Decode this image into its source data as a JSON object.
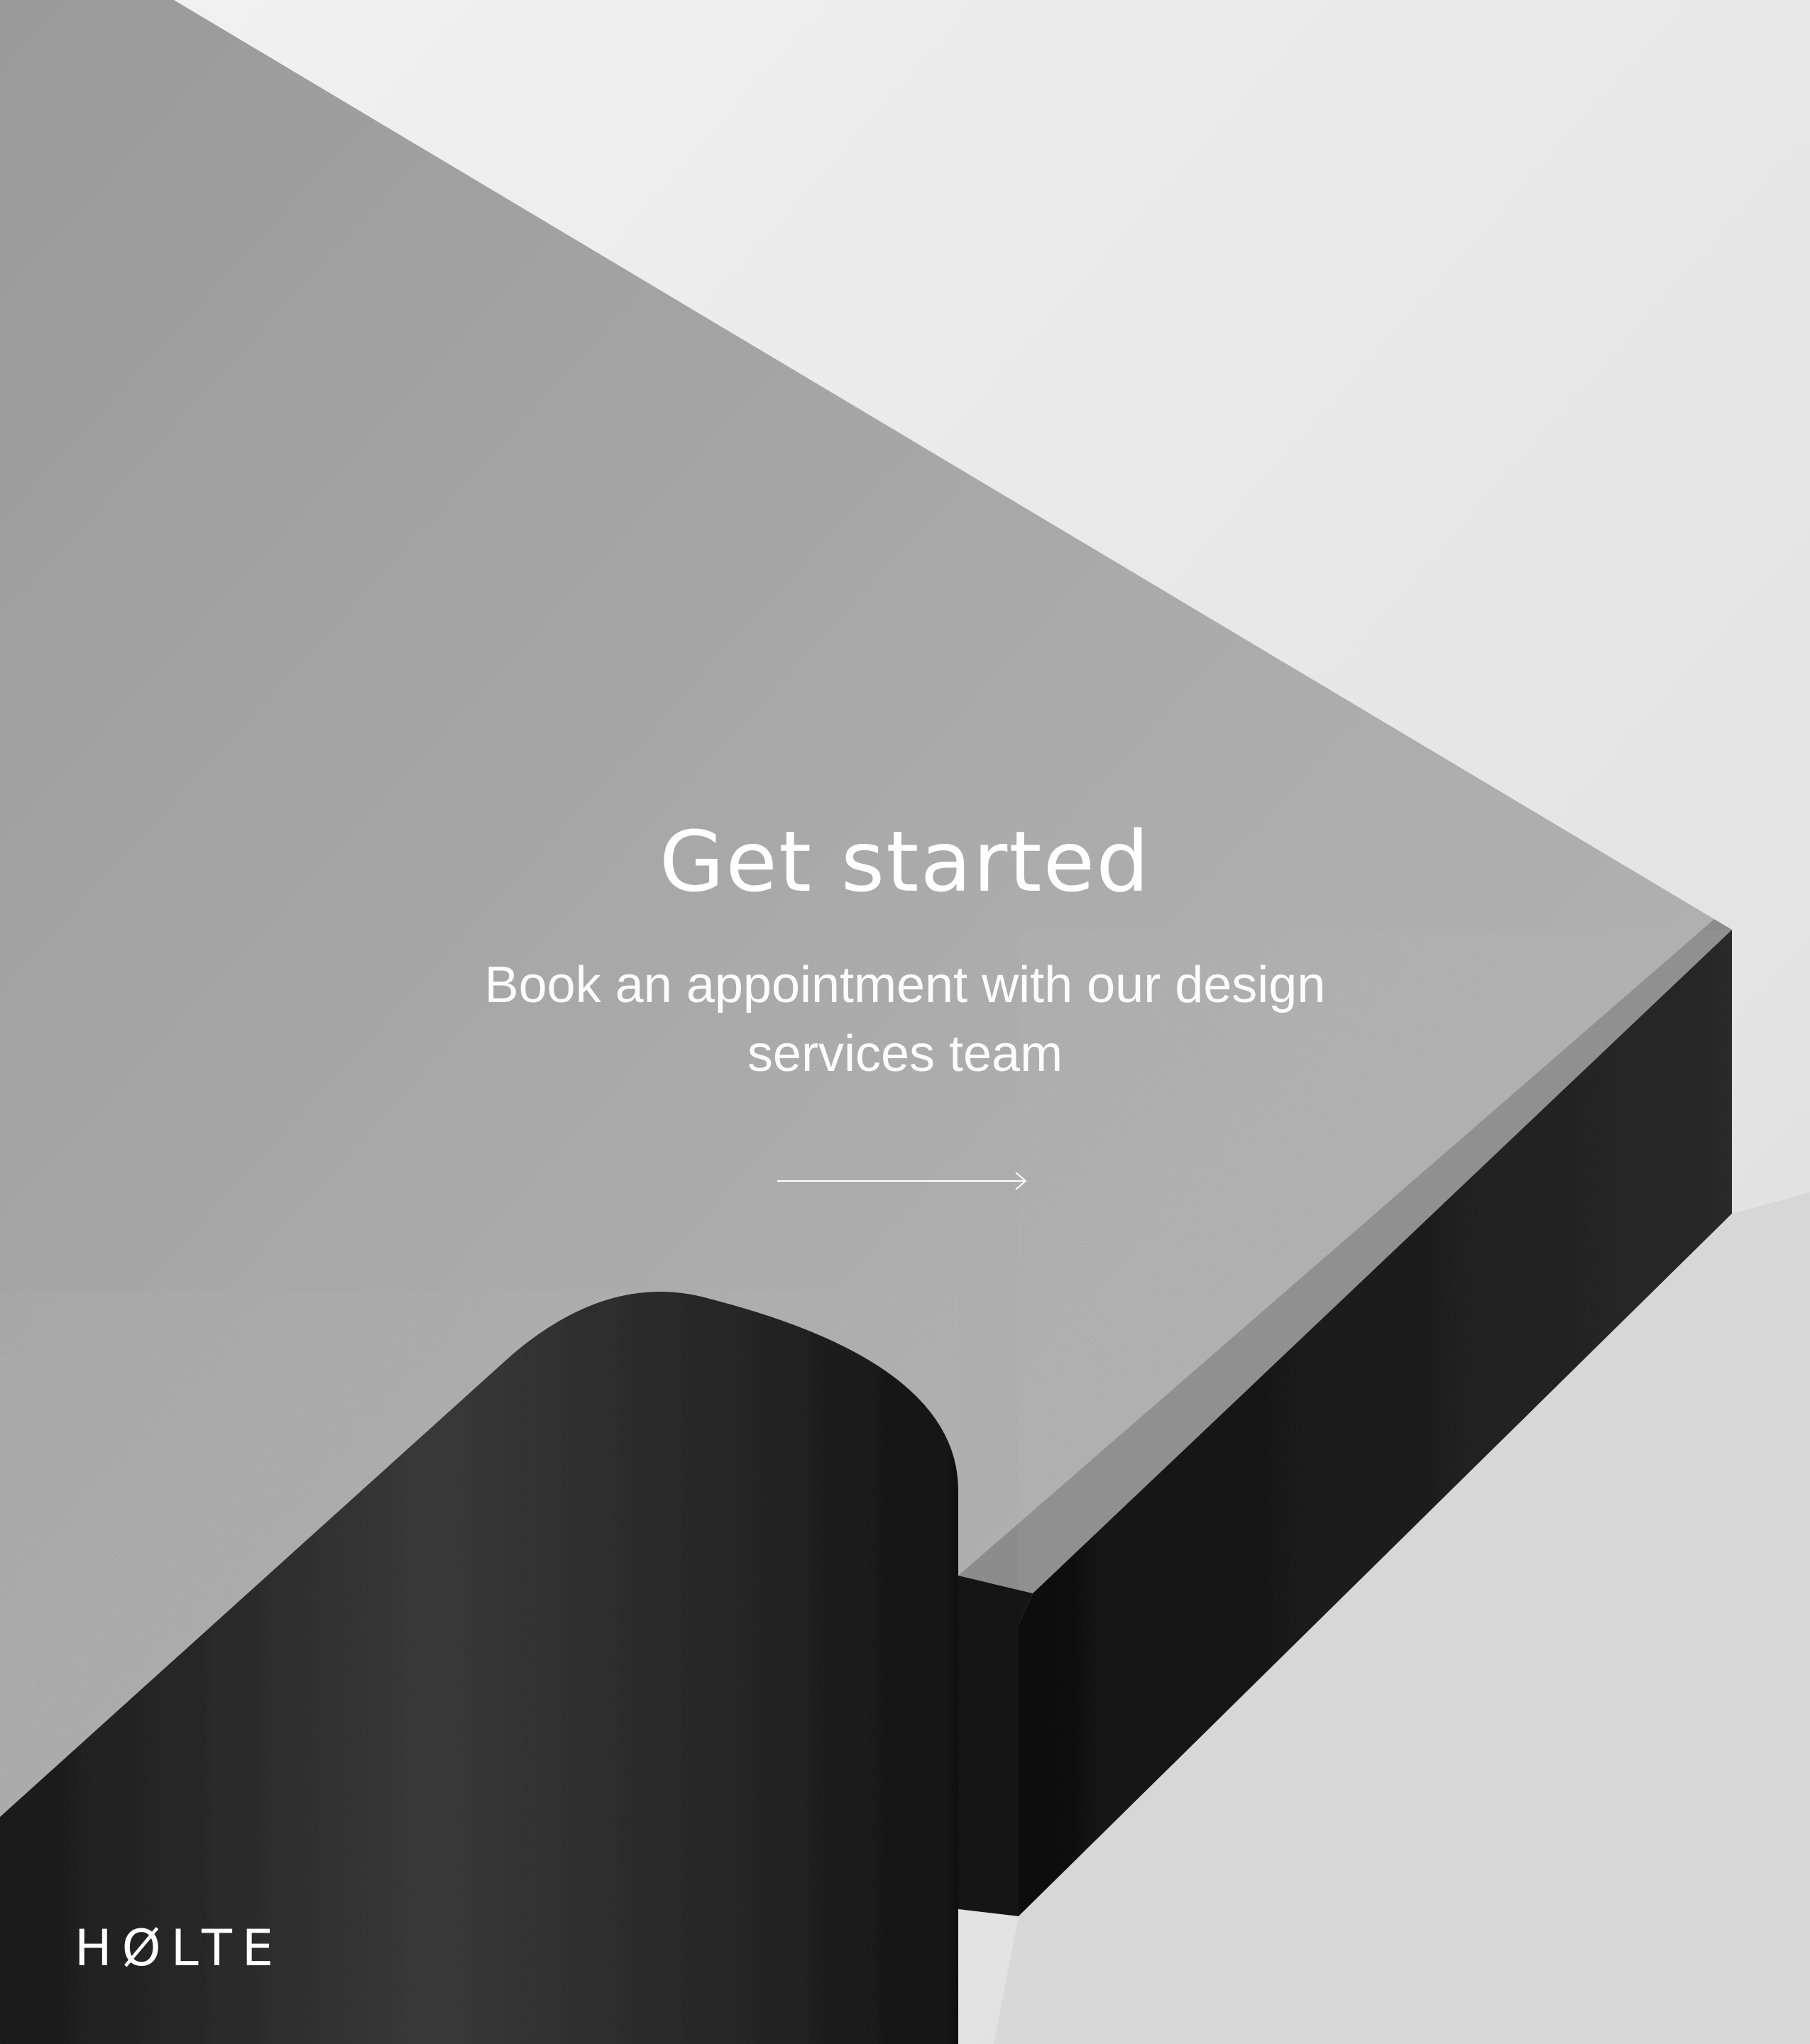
{
  "hero": {
    "title": "Get started",
    "subtitle": "Book an appointment with our design services team",
    "arrow_icon": "arrow-right-icon"
  },
  "brand": {
    "logo_text": "HØLTE"
  },
  "colors": {
    "text": "#ffffff",
    "background": "#e6e6e6",
    "panel": "#a9a9a9",
    "edge": "#1c1c1c"
  }
}
